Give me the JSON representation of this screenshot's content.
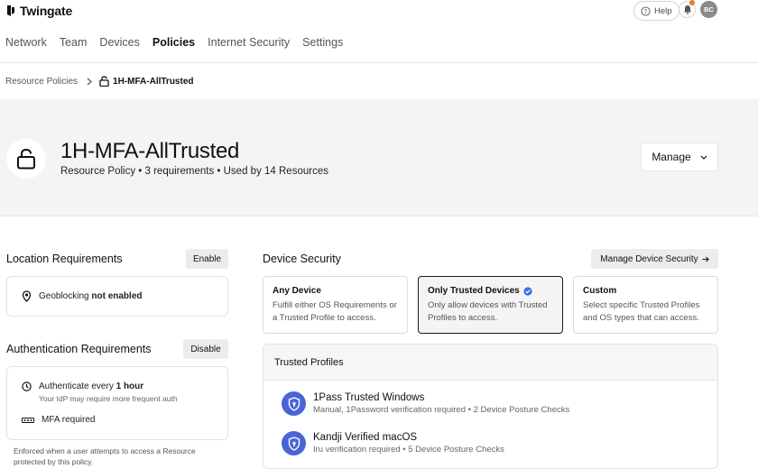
{
  "brand": {
    "name": "Twingate"
  },
  "nav": {
    "items": [
      {
        "label": "Network"
      },
      {
        "label": "Team"
      },
      {
        "label": "Devices"
      },
      {
        "label": "Policies",
        "active": true
      },
      {
        "label": "Internet Security"
      },
      {
        "label": "Settings"
      }
    ]
  },
  "header_actions": {
    "help_label": "Help",
    "avatar_initials": "BC",
    "notification_dot_color": "#e8772e"
  },
  "breadcrumb": {
    "parent": "Resource Policies",
    "current": "1H-MFA-AllTrusted"
  },
  "hero": {
    "title": "1H-MFA-AllTrusted",
    "subtitle": "Resource Policy • 3 requirements • Used by 14 Resources",
    "manage_label": "Manage"
  },
  "location": {
    "title": "Location Requirements",
    "button_label": "Enable",
    "geo_label": "Geoblocking",
    "geo_status": "not enabled"
  },
  "auth": {
    "title": "Authentication Requirements",
    "button_label": "Disable",
    "reauth_prefix": "Authenticate every",
    "reauth_value": "1 hour",
    "reauth_hint": "Your IdP may require more frequent auth",
    "mfa_label": "MFA required",
    "footnote": "Enforced when a user attempts to access a Resource protected by this policy."
  },
  "device_security": {
    "title": "Device Security",
    "manage_label": "Manage Device Security",
    "options": [
      {
        "title": "Any Device",
        "desc": "Fulfill either OS Requirements or a Trusted Profile to access.",
        "selected": false
      },
      {
        "title": "Only Trusted Devices",
        "desc": "Only allow devices with Trusted Profiles to access.",
        "selected": true
      },
      {
        "title": "Custom",
        "desc": "Select specific Trusted Profiles and OS types that can access.",
        "selected": false
      }
    ],
    "accent_color": "#4a64d8"
  },
  "trusted_profiles": {
    "title": "Trusted Profiles",
    "items": [
      {
        "name": "1Pass Trusted Windows",
        "meta": "Manual, 1Password verification required • 2 Device Posture Checks"
      },
      {
        "name": "Kandji Verified macOS",
        "meta": "Iru verification required • 5 Device Posture Checks"
      }
    ]
  }
}
